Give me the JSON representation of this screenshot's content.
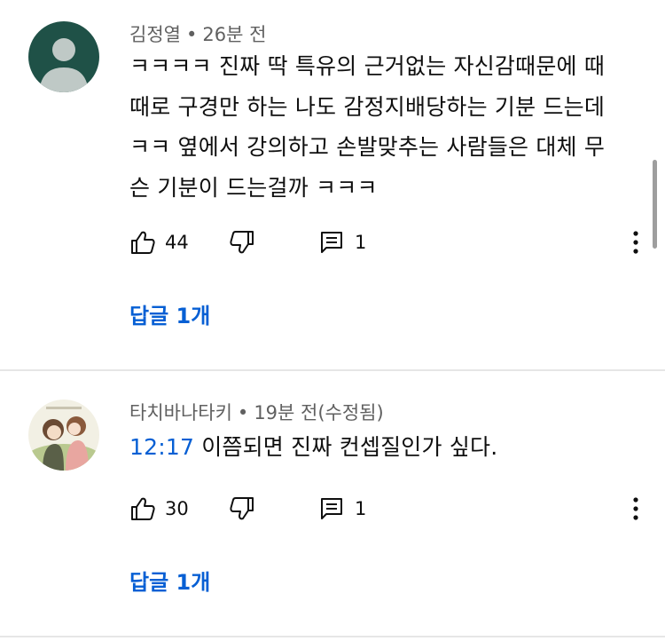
{
  "comments": [
    {
      "author": "김정열",
      "separator": "•",
      "time": "26분 전",
      "text_lines": [
        "ㅋㅋㅋㅋ 진짜 딱 특유의 근거없는 자신감때문에 때",
        "때로 구경만 하는 나도 감정지배당하는 기분 드는데",
        "ㅋㅋ 옆에서 강의하고 손발맞추는 사람들은 대체 무",
        "슨 기분이 드는걸까 ㅋㅋㅋ"
      ],
      "likes": "44",
      "reply_count": "1",
      "replies_label": "답글 1개",
      "avatar_color": "#1f5147"
    },
    {
      "author": "타치바나타키",
      "separator": "•",
      "time": "19분 전(수정됨)",
      "timestamp_link": "12:17",
      "text": "이쯤되면 진짜 컨셉질인가 싶다.",
      "likes": "30",
      "reply_count": "1",
      "replies_label": "답글 1개"
    }
  ],
  "icons": {
    "like": "thumb-up-icon",
    "dislike": "thumb-down-icon",
    "reply": "comment-icon",
    "more": "more-vert-icon"
  },
  "colors": {
    "link": "#065fd4",
    "meta": "#606060",
    "text": "#0f0f0f",
    "divider": "#e6e6e6"
  }
}
